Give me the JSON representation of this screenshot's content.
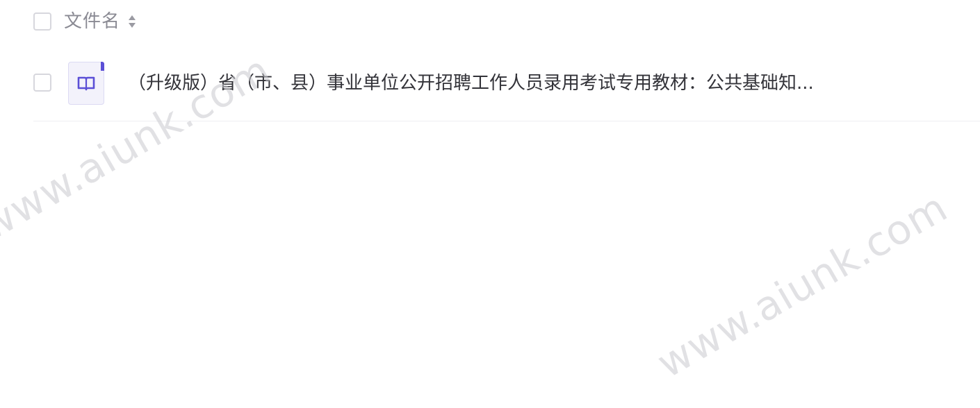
{
  "header": {
    "filename_label": "文件名"
  },
  "files": [
    {
      "name": "（升级版）省（市、县）事业单位公开招聘工作人员录用考试专用教材：公共基础知..."
    }
  ],
  "watermarks": [
    "www.aiunk.com",
    "www.aiunk.com"
  ],
  "colors": {
    "accent": "#5b4fd6",
    "header_text": "#8a8a93",
    "row_text": "#333339",
    "watermark": "#c8c8ce"
  },
  "icons": {
    "sort": "sort-icon",
    "file": "book-icon"
  }
}
